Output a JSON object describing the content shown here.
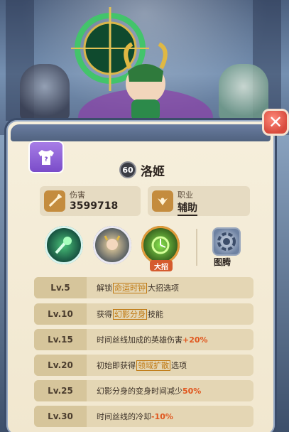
{
  "hero": {
    "level": "60",
    "name": "洛姬"
  },
  "stats": {
    "damage_label": "伤害",
    "damage_value": "3599718",
    "role_label": "职业",
    "role_value": "辅助"
  },
  "skills": {
    "ult_tag": "大招",
    "totem_label": "图腾"
  },
  "talents": [
    {
      "lv": "Lv.5",
      "pre": "解锁",
      "tag": "命运时钟",
      "post": "大招选项",
      "num": ""
    },
    {
      "lv": "Lv.10",
      "pre": "获得",
      "tag": "幻影分身",
      "post": "技能",
      "num": ""
    },
    {
      "lv": "Lv.15",
      "pre": "时间丝线加成的英雄伤害",
      "tag": "",
      "post": "",
      "num": "+20%"
    },
    {
      "lv": "Lv.20",
      "pre": "初始即获得",
      "tag": "领域扩散",
      "post": "选项",
      "num": ""
    },
    {
      "lv": "Lv.25",
      "pre": "幻影分身的变身时间减少",
      "tag": "",
      "post": "",
      "num": "50%"
    },
    {
      "lv": "Lv.30",
      "pre": "时间丝线的冷却",
      "tag": "",
      "post": "",
      "num": "-10%"
    }
  ],
  "close_label": "✕"
}
